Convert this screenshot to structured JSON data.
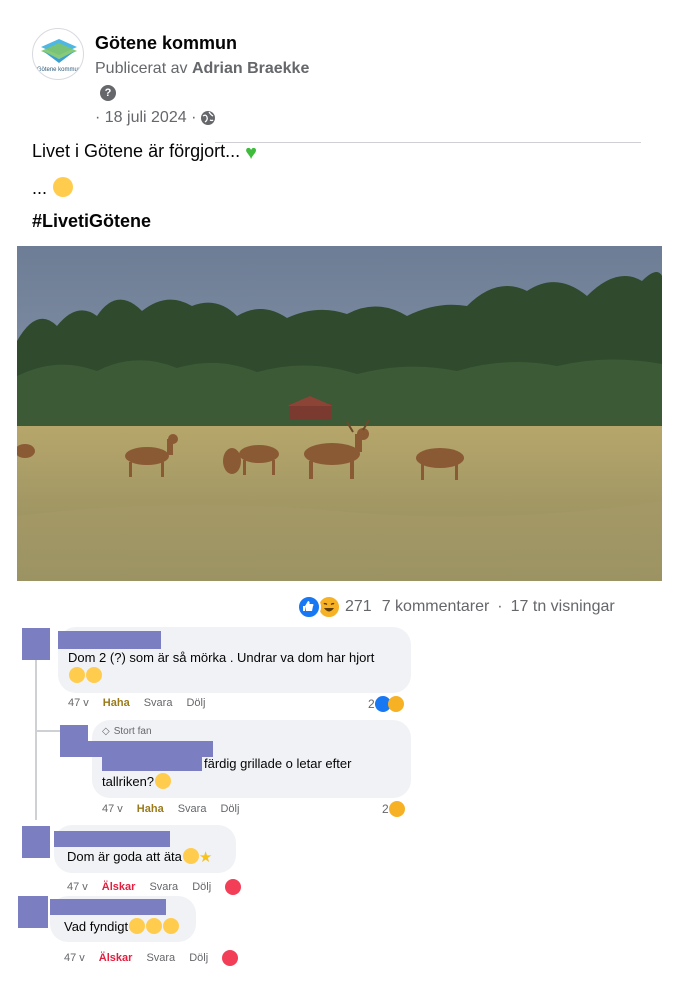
{
  "post": {
    "page_name": "Götene kommun",
    "logo_text": "Götene kommun",
    "published_prefix": "Publicerat av",
    "publisher": "Adrian Braekke",
    "help_symbol": "?",
    "date": "· 18 juli 2024 ·",
    "text_line1": "Livet i Götene är förgjort...",
    "text_line2": "...",
    "hashtag": "#LivetiGötene"
  },
  "stats": {
    "reaction_count": "271",
    "comments": "7 kommentarer",
    "separator": "·",
    "views": "17 tn visningar"
  },
  "comments": [
    {
      "text": "Dom 2 (?) som är så mörka . Undrar va dom har hjort",
      "age": "47 v",
      "reaction_label": "Haha",
      "reply": "Svara",
      "hide": "Dölj",
      "reaction_count": "2"
    },
    {
      "badge": "Stort fan",
      "text_line1": "färdig grillade o letar efter",
      "text_line2": "tallriken?",
      "age": "47 v",
      "reaction_label": "Haha",
      "reply": "Svara",
      "hide": "Dölj",
      "reaction_count": "2"
    },
    {
      "text": "Dom är goda att äta",
      "age": "47 v",
      "reaction_label": "Älskar",
      "reply": "Svara",
      "hide": "Dölj"
    },
    {
      "text": "Vad fyndigt",
      "age": "47 v",
      "reaction_label": "Älskar",
      "reply": "Svara",
      "hide": "Dölj"
    }
  ],
  "colors": {
    "like_blue": "#1877f2",
    "haha_yellow": "#f7b125",
    "love_red": "#f33e58",
    "redaction": "#7b7fc2"
  },
  "icons": [
    "help-icon",
    "globe-icon",
    "green-heart-icon",
    "like-icon",
    "haha-icon",
    "love-icon",
    "diamond-icon"
  ]
}
